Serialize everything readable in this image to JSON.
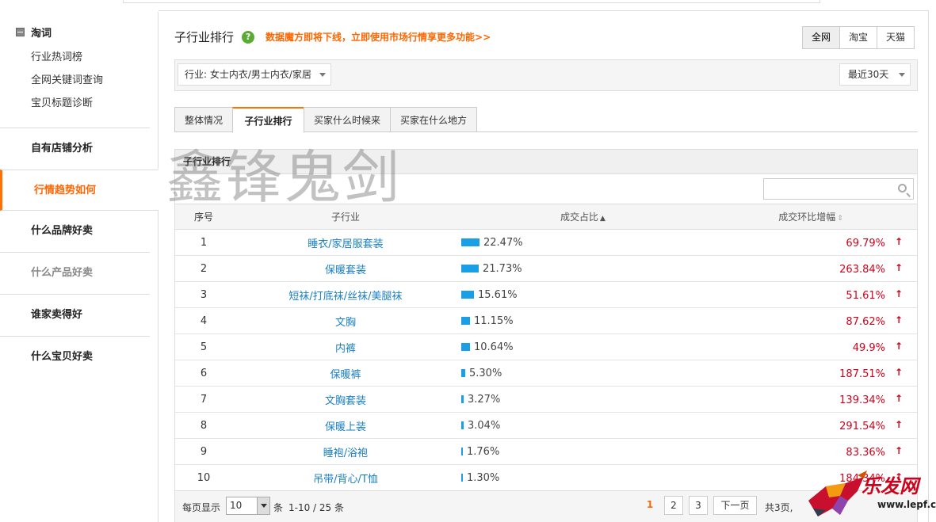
{
  "sidebar": {
    "group_title": "淘词",
    "sub_items": [
      "行业热词榜",
      "全网关键词查询",
      "宝贝标题诊断"
    ],
    "items": [
      {
        "label": "自有店铺分析",
        "state": "normal"
      },
      {
        "label": "行情趋势如何",
        "state": "active"
      },
      {
        "label": "什么品牌好卖",
        "state": "normal"
      },
      {
        "label": "什么产品好卖",
        "state": "muted"
      },
      {
        "label": "谁家卖得好",
        "state": "normal"
      },
      {
        "label": "什么宝贝好卖",
        "state": "normal"
      }
    ]
  },
  "header": {
    "title": "子行业排行",
    "help_icon": "?",
    "notice": "数据魔方即将下线，立即使用市场行情享更多功能>>"
  },
  "market_tabs": [
    "全网",
    "淘宝",
    "天猫"
  ],
  "filter": {
    "industry": "行业: 女士内衣/男士内衣/家居",
    "period": "最近30天"
  },
  "tabs": [
    "整体情况",
    "子行业排行",
    "买家什么时候来",
    "买家在什么地方"
  ],
  "active_tab": 1,
  "panel": {
    "title": "子行业排行",
    "search_placeholder": ""
  },
  "table": {
    "headers": [
      "序号",
      "子行业",
      "成交占比",
      "成交环比增幅"
    ],
    "rows": [
      {
        "no": "1",
        "name": "睡衣/家居服套装",
        "share": "22.47%",
        "share_value": 22.47,
        "growth": "69.79%"
      },
      {
        "no": "2",
        "name": "保暖套装",
        "share": "21.73%",
        "share_value": 21.73,
        "growth": "263.84%"
      },
      {
        "no": "3",
        "name": "短袜/打底袜/丝袜/美腿袜",
        "share": "15.61%",
        "share_value": 15.61,
        "growth": "51.61%"
      },
      {
        "no": "4",
        "name": "文胸",
        "share": "11.15%",
        "share_value": 11.15,
        "growth": "87.62%"
      },
      {
        "no": "5",
        "name": "内裤",
        "share": "10.64%",
        "share_value": 10.64,
        "growth": "49.9%"
      },
      {
        "no": "6",
        "name": "保暖裤",
        "share": "5.30%",
        "share_value": 5.3,
        "growth": "187.51%"
      },
      {
        "no": "7",
        "name": "文胸套装",
        "share": "3.27%",
        "share_value": 3.27,
        "growth": "139.34%"
      },
      {
        "no": "8",
        "name": "保暖上装",
        "share": "3.04%",
        "share_value": 3.04,
        "growth": "291.54%"
      },
      {
        "no": "9",
        "name": "睡袍/浴袍",
        "share": "1.76%",
        "share_value": 1.76,
        "growth": "83.36%"
      },
      {
        "no": "10",
        "name": "吊带/背心/T恤",
        "share": "1.30%",
        "share_value": 1.3,
        "growth": "184.34%"
      }
    ]
  },
  "pager": {
    "per_page_label": "每页显示",
    "per_page_value": "10",
    "unit": "条",
    "range_text": "1-10 / 25 条",
    "pages": [
      "1",
      "2",
      "3"
    ],
    "current_page": "1",
    "next_label": "下一页",
    "total_pages_text": "共3页,"
  },
  "watermark": {
    "text": "鑫锋鬼剑",
    "logo_text": "乐发网",
    "logo_url": "www.lepf.cn"
  },
  "colors": {
    "accent": "#ff6600",
    "link": "#1a7fc3",
    "bar": "#1a9ee6",
    "growth": "#d0021b"
  }
}
